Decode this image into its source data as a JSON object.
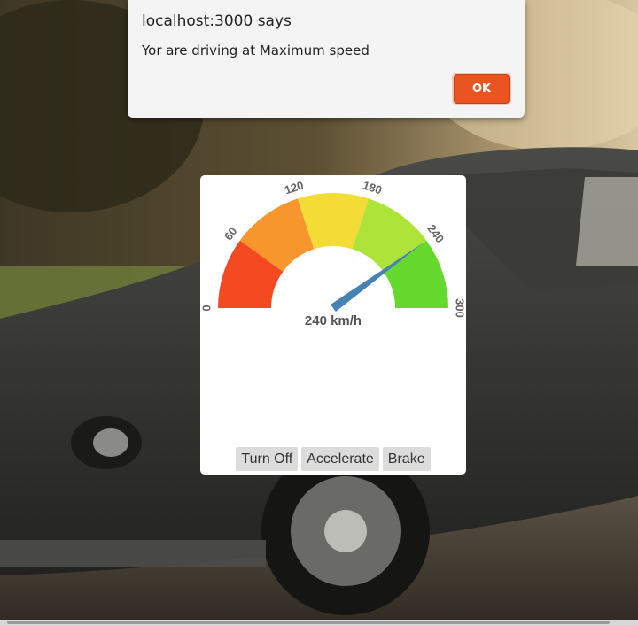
{
  "dialog": {
    "title": "localhost:3000 says",
    "message": "Yor are driving at Maximum speed",
    "ok_label": "OK"
  },
  "speedometer": {
    "value": 240,
    "readout": "240 km/h",
    "min": 0,
    "max": 300,
    "ticks": [
      "0",
      "60",
      "120",
      "180",
      "240",
      "300"
    ],
    "band_colors": [
      "#f44a22",
      "#f7962d",
      "#f2dc35",
      "#aee33a",
      "#66d92f"
    ],
    "needle_color": "#4682b4"
  },
  "controls": {
    "turn_off": "Turn Off",
    "accelerate": "Accelerate",
    "brake": "Brake"
  }
}
